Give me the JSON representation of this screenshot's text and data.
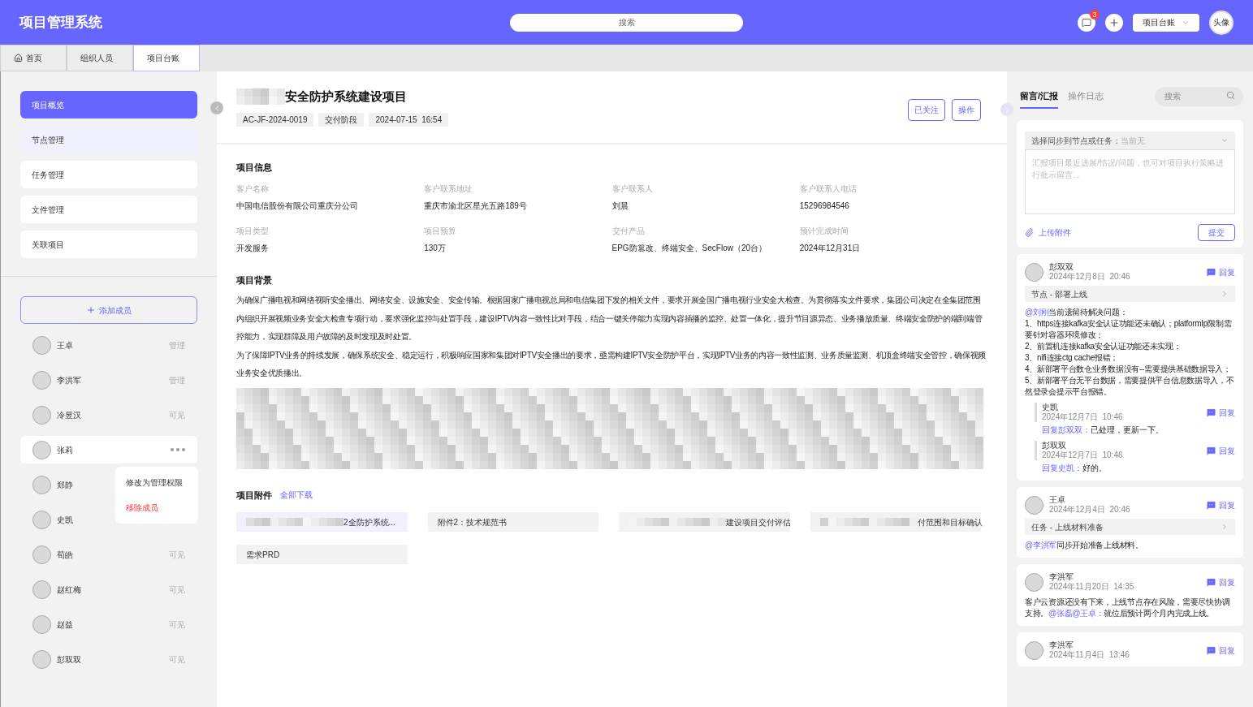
{
  "app": {
    "title": "项目管理系统"
  },
  "header": {
    "search_placeholder": "搜索",
    "notification_count": "3",
    "project_menu": "项目台账",
    "avatar": "头像"
  },
  "tabs": [
    {
      "label": "首页",
      "kind": "home",
      "selected": false
    },
    {
      "label": "组织人员",
      "kind": "plain",
      "selected": false
    },
    {
      "label": "项目台账",
      "kind": "plain",
      "selected": true
    }
  ],
  "sidebar": {
    "items": [
      {
        "label": "项目概览",
        "selected": true,
        "hovered": false
      },
      {
        "label": "节点管理",
        "selected": false,
        "hovered": true
      },
      {
        "label": "任务管理",
        "selected": false,
        "hovered": false
      },
      {
        "label": "文件管理",
        "selected": false,
        "hovered": false
      },
      {
        "label": "关联项目",
        "selected": false,
        "hovered": false
      }
    ],
    "add_member": "添加成员",
    "members": [
      {
        "name": "王卓",
        "kind": "role",
        "role": "管理",
        "hovered": false
      },
      {
        "name": "李洪军",
        "kind": "role",
        "role": "管理",
        "hovered": false
      },
      {
        "name": "冷昱汉",
        "kind": "role",
        "role": "可见",
        "hovered": false
      },
      {
        "name": "张莉",
        "kind": "more",
        "hovered": true
      },
      {
        "name": "郑静",
        "kind": "plain",
        "hovered": false
      },
      {
        "name": "史凯",
        "kind": "plain",
        "hovered": false
      },
      {
        "name": "荀皓",
        "kind": "role",
        "role": "可见",
        "hovered": false
      },
      {
        "name": "赵红梅",
        "kind": "role",
        "role": "可见",
        "hovered": false
      },
      {
        "name": "赵益",
        "kind": "role",
        "role": "可见",
        "hovered": false
      },
      {
        "name": "彭双双",
        "kind": "role",
        "role": "可见",
        "hovered": false
      }
    ],
    "member_menu": [
      {
        "label": "修改为管理权限",
        "kind": "normal"
      },
      {
        "label": "移除成员",
        "kind": "danger"
      }
    ]
  },
  "project": {
    "title": "安全防护系统建设项目",
    "tags": [
      "AC-JF-2024-0019",
      "交付阶段",
      "2024-07-15  16:54"
    ],
    "buttons": [
      "已关注",
      "操作"
    ]
  },
  "info": {
    "heading": "项目信息",
    "fields": [
      {
        "label": "客户名称",
        "value": "中国电信股份有限公司重庆分公司"
      },
      {
        "label": "客户联系地址",
        "value": "重庆市渝北区星光五路189号"
      },
      {
        "label": "客户联系人",
        "value": "刘晨"
      },
      {
        "label": "客户联系人电话",
        "value": "15296984546"
      },
      {
        "label": "项目类型",
        "value": "开发服务"
      },
      {
        "label": "项目预算",
        "value": "130万"
      },
      {
        "label": "交付产品",
        "value": "EPG防篡改、终端安全、SecFlow（20台）"
      },
      {
        "label": "预计完成时间",
        "value": "2024年12月31日"
      }
    ]
  },
  "background": {
    "heading": "项目背景",
    "paragraphs": [
      "为确保广播电视和网络视听安全播出、网络安全、设施安全、安全传输。根据国家广播电视总局和电信集团下发的相关文件，要求开展全国广播电视行业安全大检查。为贯彻落实文件要求，集团公司决定在全集团范围内组织开展视频业务安全大检查专项行动，要求强化监控与处置手段，建设IPTV内容一致性比对手段，结合一键关停能力实现内容插播的监控、处置一体化，提升节目源异态、业务播放质量、终端安全防护的端到端管控能力，实现群障及用户故障的及时发现及时处置。",
      "为了保障IPTV业务的持续发展，确保系统安全、稳定运行，积极响应国家和集团对IPTV安全播出的要求，亟需构建IPTV安全防护平台，实现IPTV业务的内容一致性监测、业务质量监测、机顶盒终端安全管控，确保视频业务安全优质播出。"
    ]
  },
  "attachments": {
    "heading": "项目附件",
    "download_all": "全部下载",
    "files": [
      {
        "name": "2全防护系统...",
        "hovered": true,
        "blurred": true
      },
      {
        "name": "附件2：技术规范书",
        "hovered": false,
        "blurred": false
      },
      {
        "name": "建设项目交付评估",
        "hovered": false,
        "blurred": true
      },
      {
        "name": "付范围和目标确认",
        "hovered": false,
        "blurred": true
      },
      {
        "name": "需求PRD",
        "hovered": false,
        "blurred": false
      }
    ]
  },
  "panel": {
    "tabs": [
      {
        "label": "留言/汇报",
        "selected": true
      },
      {
        "label": "操作日志",
        "selected": false
      }
    ],
    "search_placeholder": "搜索",
    "composer": {
      "sync_label": "选择同步到节点或任务：",
      "sync_value": "当前无",
      "placeholder": "汇报项目最近进展/情况/问题，也可对项目执行策略进行批示留言...",
      "upload": "上传附件",
      "submit": "提交"
    },
    "messages": [
      {
        "author": "彭双双",
        "time": "2024年12月8日  20:46",
        "reply": "回复",
        "link": "节点 - 部署上线",
        "body": [
          {
            "kind": "mention",
            "text": "@刘刚"
          },
          {
            "kind": "text",
            "text": "当前遗留待解决问题：\n1、https连接kafka安全认证功能还未确认；platformIp限制需要针对容器环境修改；\n2、前置机连接kafka安全认证功能还未实现；\n3、nifi连接ctg cache报错；\n4、新部署平台数仓业务数据没有--需要提供基础数据导入；\n5、新部署平台无平台数据，需要提供平台信息数据导入，不然登录会提示平台报错。"
          }
        ],
        "replies": [
          {
            "author": "史凯",
            "time": "2024年12月7日  10:46",
            "reply": "回复",
            "target": "回复彭双双：",
            "text": "已处理，更新一下。"
          },
          {
            "author": "彭双双",
            "time": "2024年12月7日  10:46",
            "reply": "回复",
            "target": "回复史凯：",
            "text": "好的。"
          }
        ]
      },
      {
        "author": "王卓",
        "time": "2024年12月4日  20:46",
        "reply": "回复",
        "link": "任务 - 上线材料准备",
        "body": [
          {
            "kind": "mention",
            "text": "@李洪军"
          },
          {
            "kind": "text",
            "text": "同步开始准备上线材料。"
          }
        ]
      },
      {
        "author": "李洪军",
        "time": "2024年11月20日  14:35",
        "reply": "回复",
        "body": [
          {
            "kind": "text",
            "text": "客户云资源还没有下来，上线节点存在风险，需要尽快协调支持。"
          },
          {
            "kind": "mention",
            "text": "@张磊@王卓："
          },
          {
            "kind": "text",
            "text": "就位后预计两个月内完成上线。"
          }
        ]
      },
      {
        "author": "李洪军",
        "time": "2024年11月4日  13:46",
        "reply": "回复"
      }
    ]
  }
}
